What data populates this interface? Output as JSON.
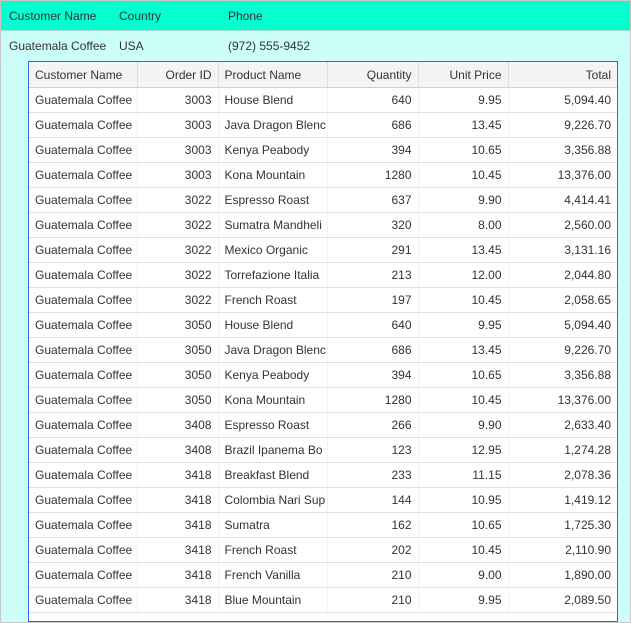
{
  "master": {
    "headers": [
      "Customer Name",
      "Country",
      "Phone"
    ],
    "row": [
      "Guatemala Coffee",
      "USA",
      "(972) 555-9452"
    ]
  },
  "detail": {
    "headers": [
      "Customer Name",
      "Order ID",
      "Product Name",
      "Quantity",
      "Unit Price",
      "Total"
    ],
    "rows": [
      [
        "Guatemala Coffee",
        "3003",
        "House Blend",
        "640",
        "9.95",
        "5,094.40"
      ],
      [
        "Guatemala Coffee",
        "3003",
        "Java Dragon Blenc",
        "686",
        "13.45",
        "9,226.70"
      ],
      [
        "Guatemala Coffee",
        "3003",
        "Kenya Peabody",
        "394",
        "10.65",
        "3,356.88"
      ],
      [
        "Guatemala Coffee",
        "3003",
        "Kona Mountain",
        "1280",
        "10.45",
        "13,376.00"
      ],
      [
        "Guatemala Coffee",
        "3022",
        "Espresso Roast",
        "637",
        "9.90",
        "4,414.41"
      ],
      [
        "Guatemala Coffee",
        "3022",
        "Sumatra Mandheli",
        "320",
        "8.00",
        "2,560.00"
      ],
      [
        "Guatemala Coffee",
        "3022",
        "Mexico Organic",
        "291",
        "13.45",
        "3,131.16"
      ],
      [
        "Guatemala Coffee",
        "3022",
        "Torrefazione Italia",
        "213",
        "12.00",
        "2,044.80"
      ],
      [
        "Guatemala Coffee",
        "3022",
        "French Roast",
        "197",
        "10.45",
        "2,058.65"
      ],
      [
        "Guatemala Coffee",
        "3050",
        "House Blend",
        "640",
        "9.95",
        "5,094.40"
      ],
      [
        "Guatemala Coffee",
        "3050",
        "Java Dragon Blenc",
        "686",
        "13.45",
        "9,226.70"
      ],
      [
        "Guatemala Coffee",
        "3050",
        "Kenya Peabody",
        "394",
        "10.65",
        "3,356.88"
      ],
      [
        "Guatemala Coffee",
        "3050",
        "Kona Mountain",
        "1280",
        "10.45",
        "13,376.00"
      ],
      [
        "Guatemala Coffee",
        "3408",
        "Espresso Roast",
        "266",
        "9.90",
        "2,633.40"
      ],
      [
        "Guatemala Coffee",
        "3408",
        "Brazil Ipanema Bo",
        "123",
        "12.95",
        "1,274.28"
      ],
      [
        "Guatemala Coffee",
        "3418",
        "Breakfast Blend",
        "233",
        "11.15",
        "2,078.36"
      ],
      [
        "Guatemala Coffee",
        "3418",
        "Colombia Nari Sup",
        "144",
        "10.95",
        "1,419.12"
      ],
      [
        "Guatemala Coffee",
        "3418",
        "Sumatra",
        "162",
        "10.65",
        "1,725.30"
      ],
      [
        "Guatemala Coffee",
        "3418",
        "French Roast",
        "202",
        "10.45",
        "2,110.90"
      ],
      [
        "Guatemala Coffee",
        "3418",
        "French Vanilla",
        "210",
        "9.00",
        "1,890.00"
      ],
      [
        "Guatemala Coffee",
        "3418",
        "Blue Mountain",
        "210",
        "9.95",
        "2,089.50"
      ]
    ]
  },
  "colors": {
    "header": "#05ffd0",
    "background": "#ccfffa",
    "grid_border": "#3366ee"
  }
}
